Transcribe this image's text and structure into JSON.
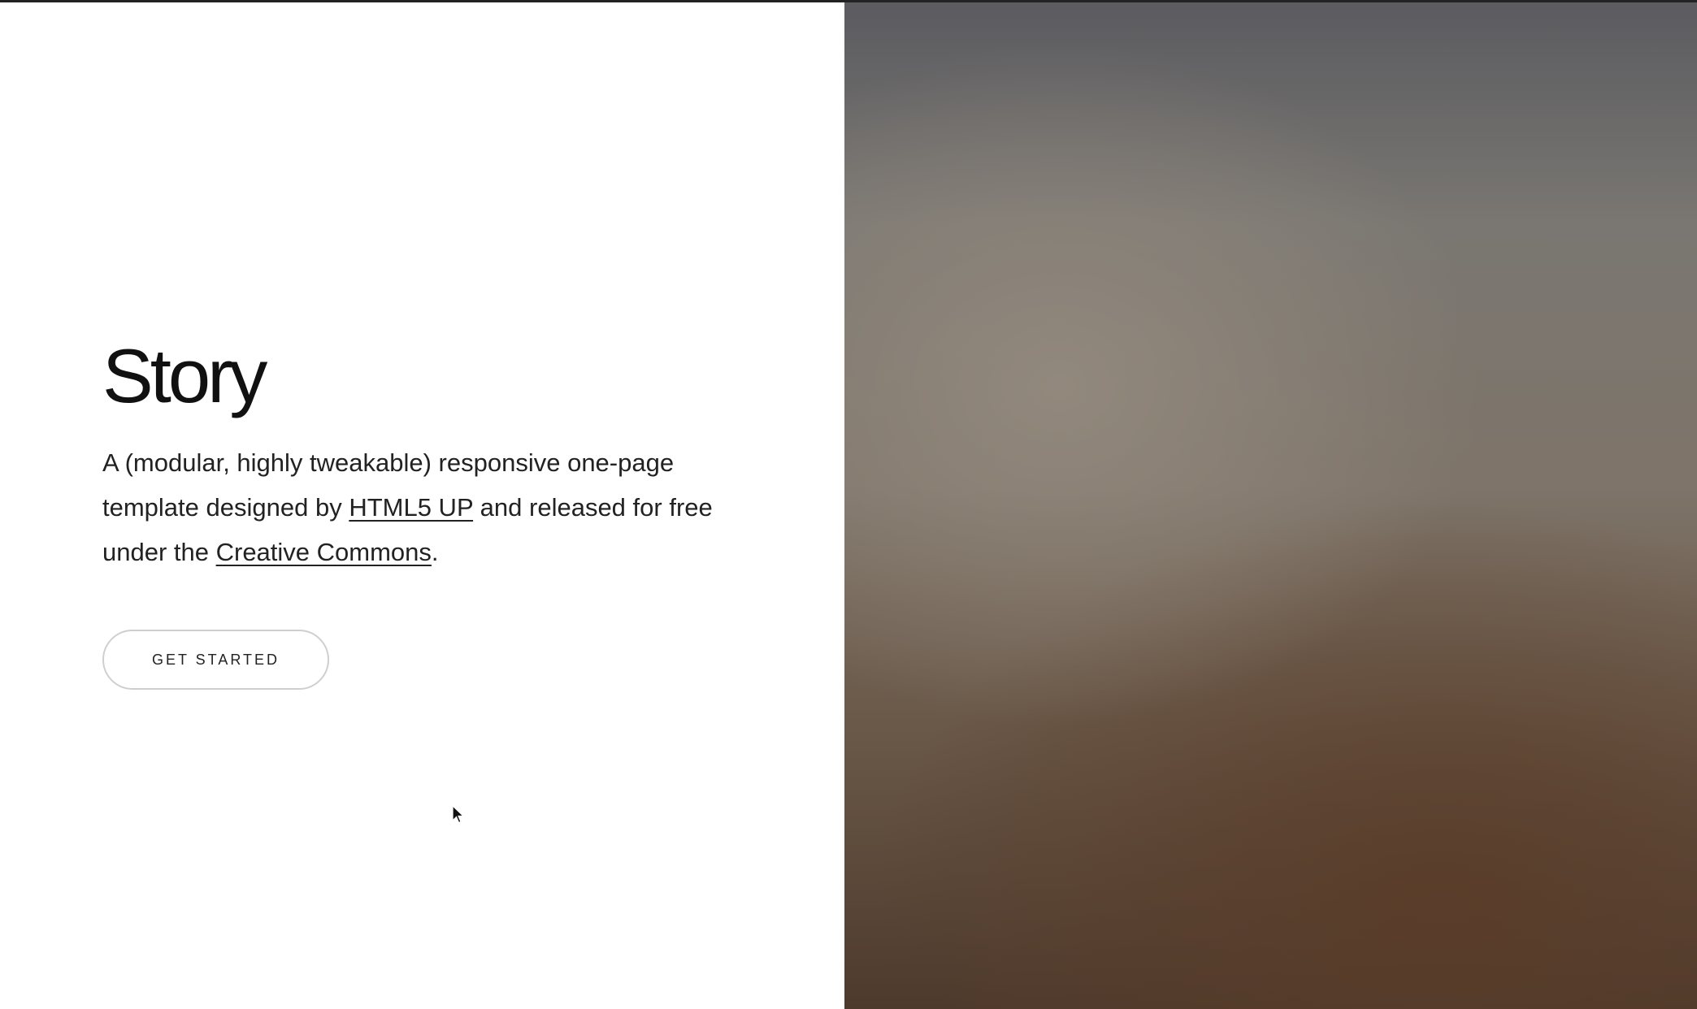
{
  "banner": {
    "title": "Story",
    "lead_part1": "A (modular, highly tweakable) responsive one-page template designed by ",
    "link1_text": "HTML5 UP",
    "lead_part2": " and released for free under the ",
    "link2_text": "Creative Commons",
    "lead_part3": ".",
    "button_label": "Get Started"
  },
  "image": {
    "icon": "background-photo"
  },
  "cursor": {
    "icon": "mouse-pointer-icon"
  }
}
